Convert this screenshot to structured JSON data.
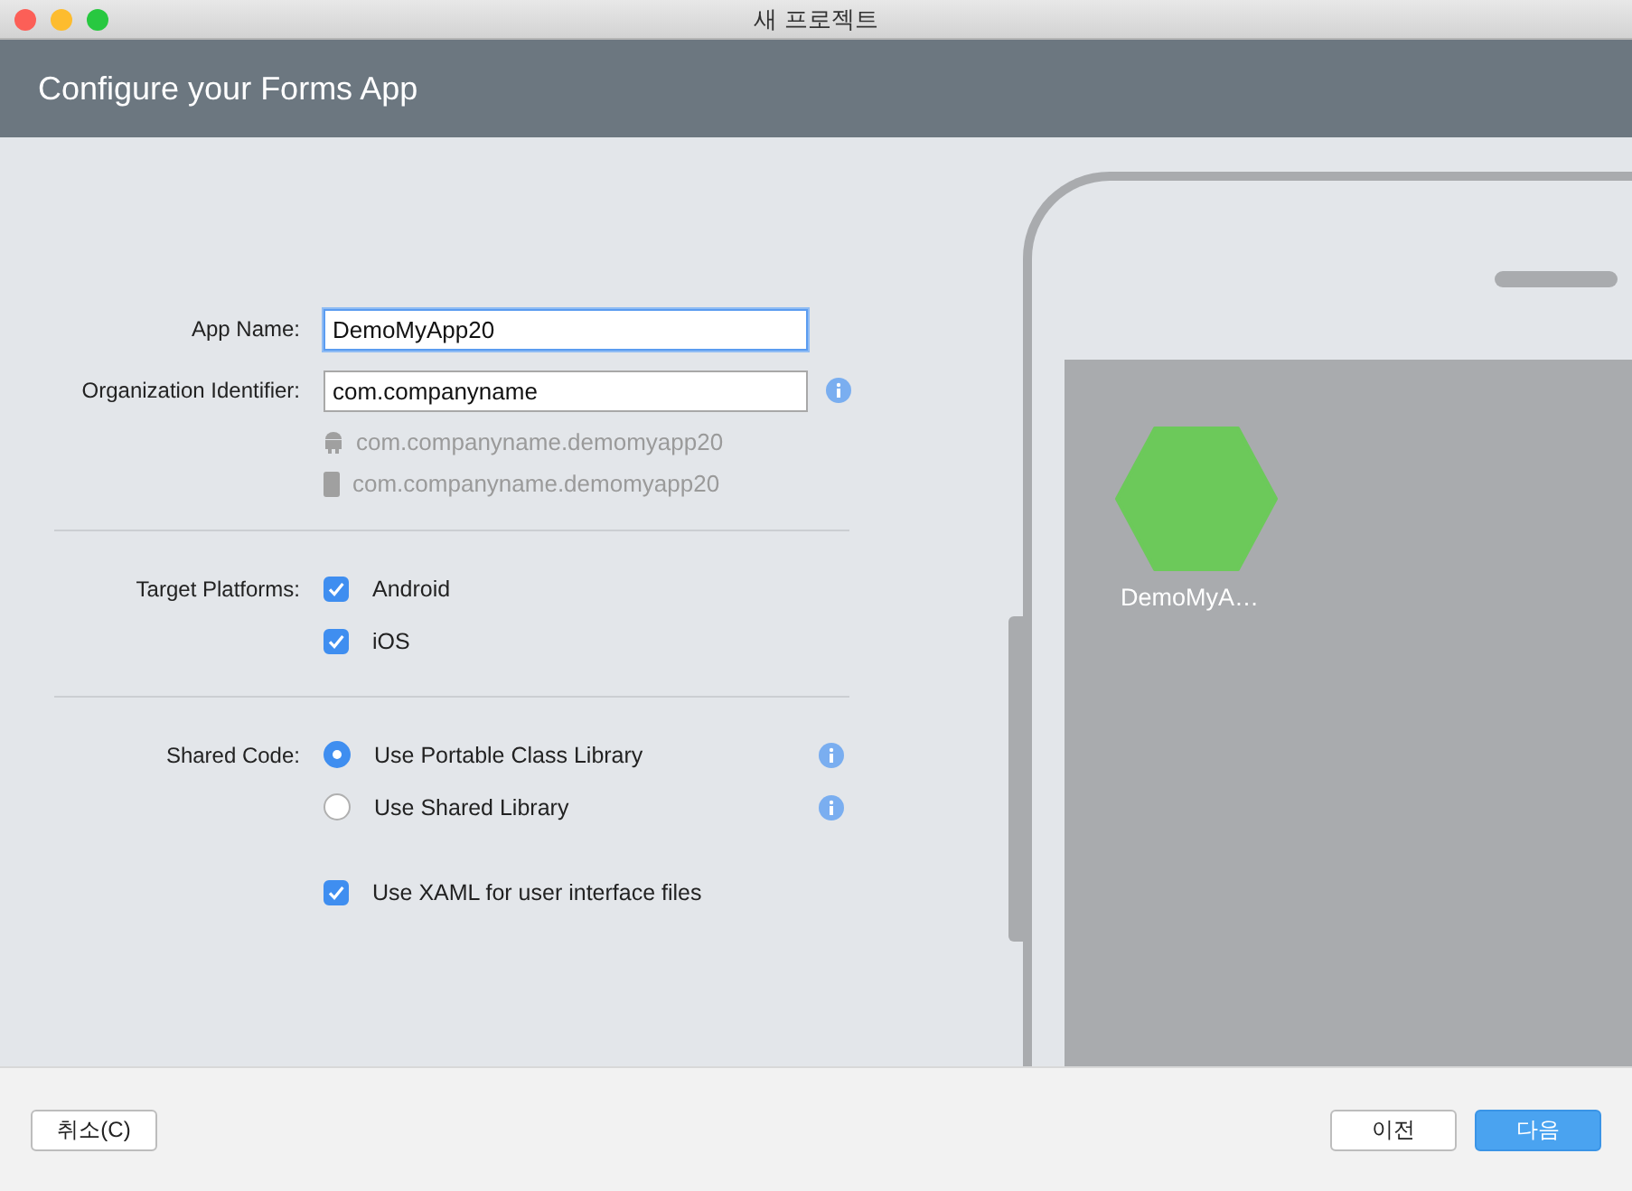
{
  "window": {
    "title": "새 프로젝트"
  },
  "header": {
    "title": "Configure your Forms App"
  },
  "app_name": {
    "label": "App Name:",
    "value": "DemoMyApp20",
    "focused": true
  },
  "organization": {
    "label": "Organization Identifier:",
    "value": "com.companyname",
    "focused": false
  },
  "bundle_ids": [
    {
      "kind": "android",
      "text": "com.companyname.demomyapp20"
    },
    {
      "kind": "ios",
      "text": "com.companyname.demomyapp20"
    }
  ],
  "target_platforms": {
    "label": "Target Platforms:",
    "options": [
      {
        "label": "Android",
        "checked": true
      },
      {
        "label": "iOS",
        "checked": true
      }
    ]
  },
  "shared_code": {
    "label": "Shared Code:",
    "options": [
      {
        "label": "Use Portable Class Library",
        "selected": true
      },
      {
        "label": "Use Shared Library",
        "selected": false
      }
    ]
  },
  "use_xaml": {
    "label": "Use XAML for user interface files",
    "checked": true
  },
  "preview": {
    "app_label": "DemoMyA…"
  },
  "buttons": [
    {
      "label": "취소(C)",
      "primary": false
    },
    {
      "label": "이전",
      "primary": false
    },
    {
      "label": "다음",
      "primary": true
    }
  ]
}
